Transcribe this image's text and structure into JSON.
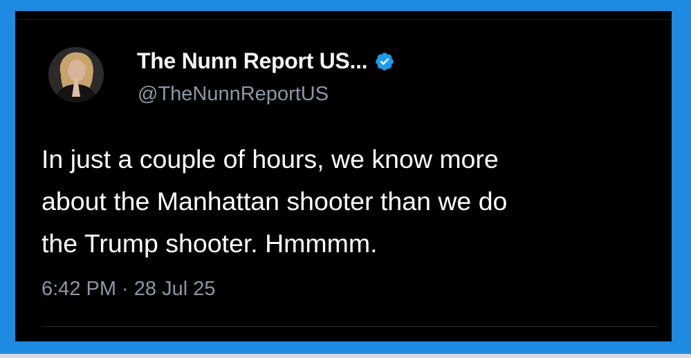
{
  "tweet": {
    "display_name": "The Nunn Report US...",
    "handle": "@TheNunnReportUS",
    "verified": true,
    "text_lines": [
      "In just a couple of hours, we know more",
      "about the Manhattan shooter than we do",
      "the Trump shooter. Hmmmm."
    ],
    "timestamp": "6:42 PM · 28 Jul 25"
  },
  "icons": {
    "verified": "verified-badge-icon",
    "avatar": "profile-photo"
  },
  "colors": {
    "frame": "#1f8ae2",
    "background": "#000000",
    "name": "#f5f5f5",
    "secondary": "#8b98a5",
    "text": "#ffffff",
    "badge": "#1d9bf0"
  }
}
